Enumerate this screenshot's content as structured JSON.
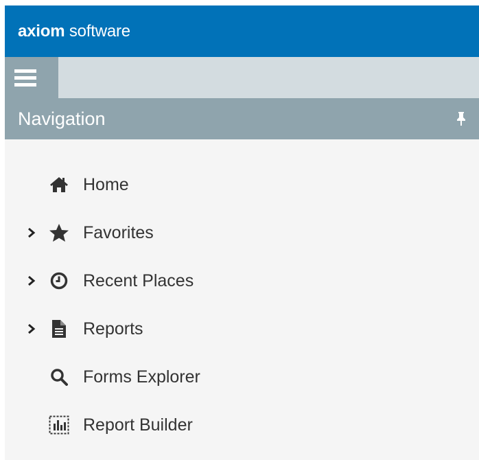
{
  "brand": {
    "bold": "axiom",
    "light": "software",
    "color": "#0172b8"
  },
  "navigation": {
    "title": "Navigation",
    "header_color": "#8fa4ad",
    "pin_icon": "pin-icon",
    "items": [
      {
        "label": "Home",
        "icon": "home-icon",
        "expandable": false
      },
      {
        "label": "Favorites",
        "icon": "star-icon",
        "expandable": true
      },
      {
        "label": "Recent Places",
        "icon": "clock-icon",
        "expandable": true
      },
      {
        "label": "Reports",
        "icon": "document-icon",
        "expandable": true
      },
      {
        "label": "Forms Explorer",
        "icon": "search-icon",
        "expandable": false
      },
      {
        "label": "Report Builder",
        "icon": "report-builder-icon",
        "expandable": false
      }
    ]
  },
  "toolbar": {
    "menu_icon": "hamburger-menu-icon"
  }
}
